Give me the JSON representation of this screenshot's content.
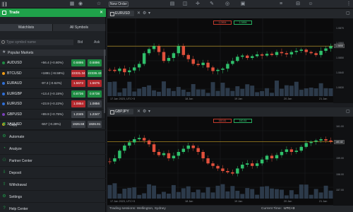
{
  "topbar": {
    "new_order": "New Order",
    "icons": [
      "home-icon",
      "grid-icon",
      "bell-icon",
      "star-icon",
      "chart-icon",
      "layout-icon",
      "menu-icon"
    ]
  },
  "left": {
    "header_title": "Trade",
    "tabs": [
      "Watchlists",
      "All Symbols"
    ],
    "search_placeholder": "Type symbol name",
    "col_bid": "Bid",
    "col_ask": "Ask",
    "section": "Popular Markets",
    "rows": [
      {
        "symbol": "AUDUSD",
        "change": "+56.4 (+0.80%)",
        "bid": "0.6895",
        "ask": "0.6896",
        "bid_color": "green",
        "ask_color": "green",
        "dot": "#1e8c43"
      },
      {
        "symbol": "BTCUSD",
        "change": "+1891 (+8.59%)",
        "bid": "22331.34",
        "ask": "22336.43",
        "bid_color": "red",
        "ask_color": "green",
        "dot": "#f39c12"
      },
      {
        "symbol": "EURAUD",
        "change": "-97.3 (-0.62%)",
        "bid": "1.5672",
        "ask": "1.5675",
        "bid_color": "red",
        "ask_color": "red",
        "dot": "#2e6fd8"
      },
      {
        "symbol": "EURGBP",
        "change": "+13.4 (+0.15%)",
        "bid": "0.8736",
        "ask": "0.8738",
        "bid_color": "green",
        "ask_color": "green",
        "dot": "#2e6fd8"
      },
      {
        "symbol": "EURUSD",
        "change": "+23.9 (+0.22%)",
        "bid": "1.0854",
        "ask": "1.0856",
        "bid_color": "red",
        "ask_color": "grey",
        "dot": "#2e6fd8"
      },
      {
        "symbol": "GBPUSD",
        "change": "+89.9 (+0.75%)",
        "bid": "1.2345",
        "ask": "1.2347",
        "bid_color": "grey",
        "ask_color": "grey",
        "dot": "#7a3fb8"
      },
      {
        "symbol": "XAUUSD",
        "change": "-557 (-0.29%)",
        "bid": "1926.58",
        "ask": "1926.91",
        "bid_color": "grey",
        "ask_color": "grey",
        "dot": "#d4a017"
      }
    ],
    "menu": [
      {
        "label": "Copy",
        "icon": "copy-icon",
        "glyph": "⧉"
      },
      {
        "label": "Automate",
        "icon": "robot-icon",
        "glyph": "⚙"
      },
      {
        "label": "Analyze",
        "icon": "analyze-icon",
        "glyph": "◔"
      },
      {
        "label": "Partner Center",
        "icon": "partner-icon",
        "glyph": "⚇"
      },
      {
        "label": "Deposit",
        "icon": "deposit-icon",
        "glyph": "⇩"
      },
      {
        "label": "Withdrawal",
        "icon": "withdrawal-icon",
        "glyph": "⇧"
      },
      {
        "label": "Settings",
        "icon": "settings-icon",
        "glyph": "⚙"
      },
      {
        "label": "Help Center",
        "icon": "help-icon",
        "glyph": "?"
      }
    ]
  },
  "charts": [
    {
      "symbol": "EURUSD",
      "sell_label": "1.0854",
      "buy_label": "1.0856",
      "time_labels": [
        "17 Jan 2023, UTC+3",
        "18 Jan",
        "19 Jan",
        "20 Jan",
        "21 Jan"
      ],
      "price_labels": [
        "1.0870",
        "1.0860",
        "1.0850",
        "1.0840",
        "1.0830"
      ],
      "current_price": "1.0855"
    },
    {
      "symbol": "GBPJPY",
      "sell_label": "160.81",
      "buy_label": "160.84",
      "time_labels": [
        "17 Jan 2023, UTC+3",
        "18 Jan",
        "19 Jan",
        "20 Jan",
        "21 Jan"
      ],
      "price_labels": [
        "161.00",
        "160.00",
        "159.00",
        "158.00",
        "157.00"
      ],
      "current_price": "160.82"
    }
  ],
  "status": {
    "sessions": "Trading sessions: Wellington, Sydney",
    "tz_label": "Current Time:",
    "tz_value": "UTC+3"
  },
  "colors": {
    "accent": "#1fa14a",
    "up": "#2fbf6a",
    "down": "#e0503c"
  }
}
